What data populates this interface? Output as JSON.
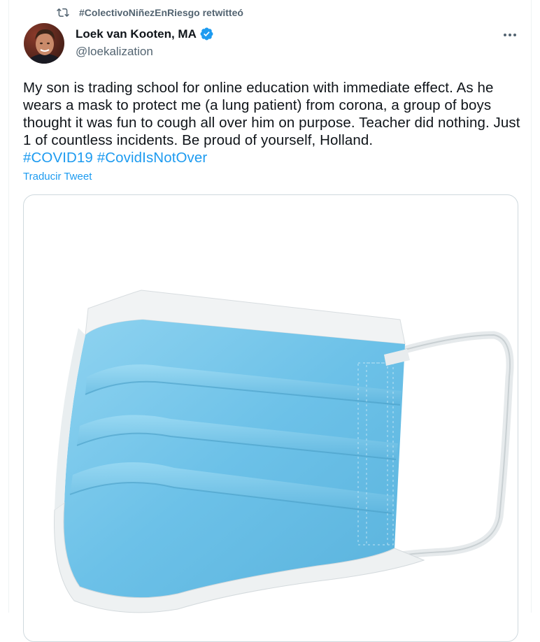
{
  "retweet": {
    "text": "#ColectivoNiñezEnRiesgo retwitteó",
    "icon": "retweet-icon"
  },
  "author": {
    "display_name": "Loek van Kooten, MA",
    "handle": "@loekalization",
    "verified": true,
    "avatar_icon": "avatar"
  },
  "tweet": {
    "text_part1": "My son is trading school for online education with immediate effect. As he wears a mask to protect me (a lung patient) from corona, a group of boys thought it was fun to cough all over him on purpose. Teacher did nothing. Just 1 of countless incidents. Be proud of yourself, Holland.",
    "hashtag1": "#COVID19",
    "hashtag2": "#CovidIsNotOver",
    "translate_label": "Traducir Tweet"
  },
  "media": {
    "image_subject": "surgical-face-mask"
  },
  "colors": {
    "accent": "#1d9bf0",
    "secondary_text": "#536471",
    "primary_text": "#0f1419"
  }
}
